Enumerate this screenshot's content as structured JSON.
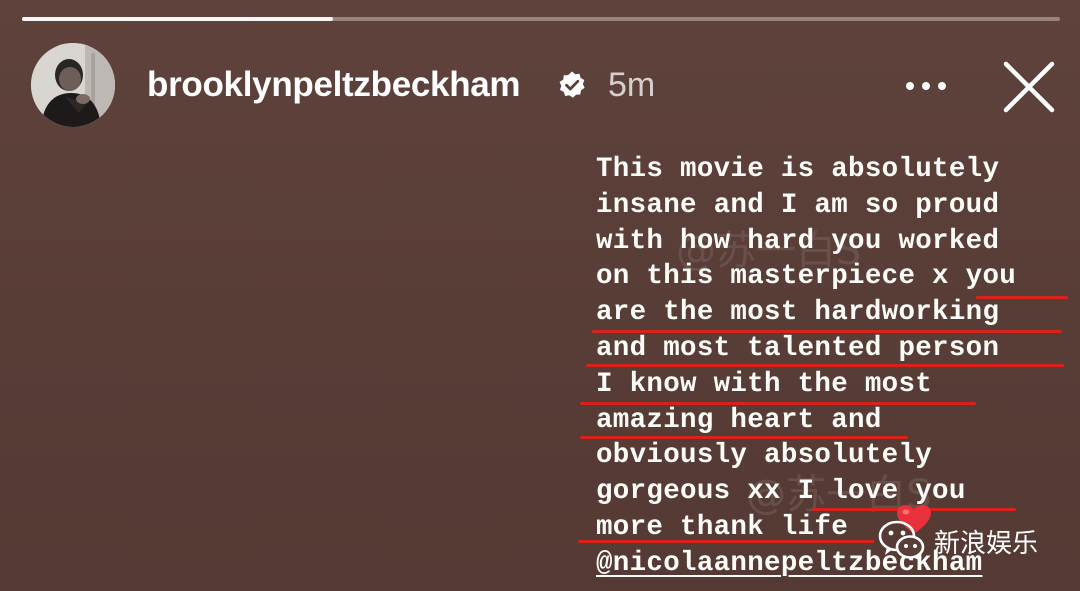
{
  "story": {
    "progress": 0.3,
    "username": "brooklynpeltzbeckham",
    "time": "5m",
    "verified": true
  },
  "header": {
    "more_icon": "more-horizontal-icon",
    "close_icon": "close-icon",
    "avatar_icon": "avatar-photo"
  },
  "caption": {
    "lines": [
      "This movie is absolutely",
      "insane and I am so proud",
      "with how hard you worked",
      "on this masterpiece x you",
      "are the most hardworking",
      "and most talented person",
      "I know with the most",
      "amazing heart and",
      "obviously absolutely",
      "gorgeous xx I love you",
      "more thank life",
      "@nicolaannepeltzbeckham"
    ],
    "emoji": "heart"
  },
  "watermark": {
    "text": "@苏一白S"
  },
  "source": {
    "label": "新浪娱乐",
    "icon": "wechat-icon"
  },
  "colors": {
    "background": "#5a3e38",
    "text": "#fbfbf8",
    "highlight_underline": "#d8231d"
  }
}
